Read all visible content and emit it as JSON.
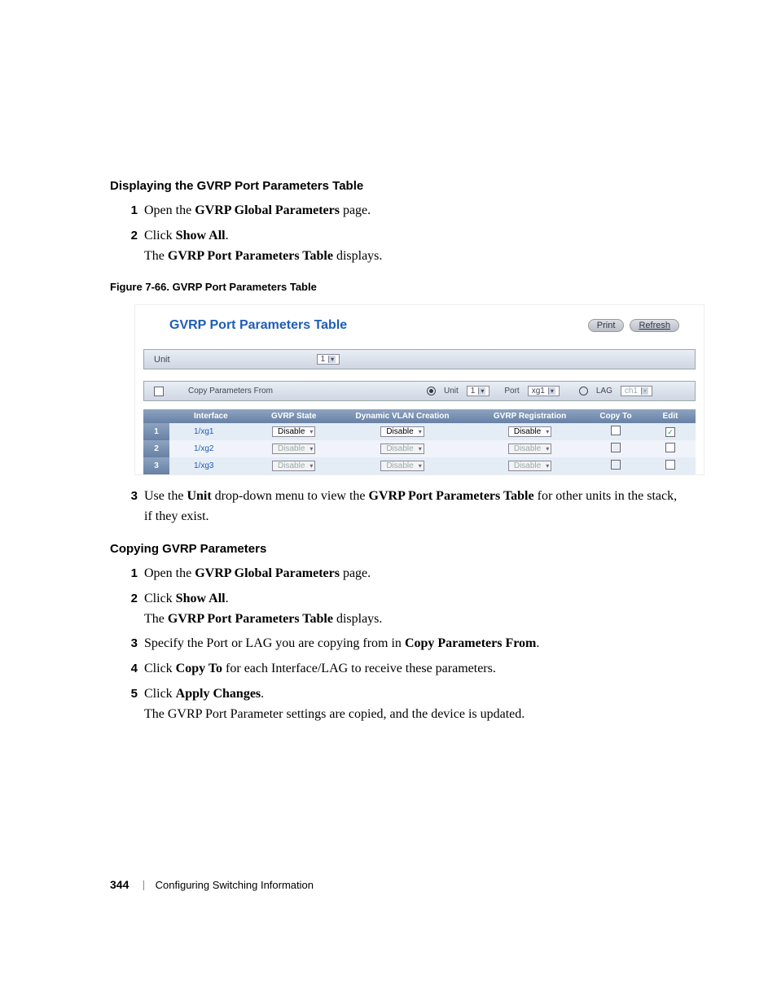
{
  "section1": {
    "heading": "Displaying the GVRP Port Parameters Table",
    "steps": [
      {
        "n": "1",
        "html": "Open the <b>GVRP Global Parameters</b> page."
      },
      {
        "n": "2",
        "html": "Click <b>Show All</b>.<br>The <b>GVRP Port Parameters Table</b> displays."
      }
    ]
  },
  "figure_caption": "Figure 7-66.    GVRP Port Parameters Table",
  "screenshot": {
    "title": "GVRP Port Parameters Table",
    "print": "Print",
    "refresh": "Refresh",
    "unit_label": "Unit",
    "unit_value": "1",
    "copy_from_label": "Copy Parameters From",
    "radio_unit_label": "Unit",
    "radio_unit_value": "1",
    "port_label": "Port",
    "port_value": "xg1",
    "radio_lag_label": "LAG",
    "lag_value": "ch1",
    "columns": {
      "interface": "Interface",
      "state": "GVRP State",
      "dvc": "Dynamic VLAN Creation",
      "reg": "GVRP Registration",
      "copyto": "Copy To",
      "edit": "Edit"
    },
    "disable": "Disable",
    "rows": [
      {
        "idx": "1",
        "iface": "1/xg1",
        "active": true,
        "edit_checked": true
      },
      {
        "idx": "2",
        "iface": "1/xg2",
        "active": false,
        "edit_checked": false
      },
      {
        "idx": "3",
        "iface": "1/xg3",
        "active": false,
        "edit_checked": false
      }
    ]
  },
  "step3": {
    "n": "3",
    "html": "Use the <b>Unit</b> drop-down menu to view the <b>GVRP Port Parameters Table</b> for other units in the stack, if they exist."
  },
  "section2": {
    "heading": "Copying GVRP Parameters",
    "steps": [
      {
        "n": "1",
        "html": "Open the <b>GVRP Global Parameters</b> page."
      },
      {
        "n": "2",
        "html": "Click <b>Show All</b>.<br>The <b>GVRP Port Parameters Table</b> displays."
      },
      {
        "n": "3",
        "html": "Specify the Port or LAG you are copying from in <b>Copy Parameters From</b>."
      },
      {
        "n": "4",
        "html": "Click <b>Copy To</b> for each Interface/LAG to receive these parameters."
      },
      {
        "n": "5",
        "html": "Click <b>Apply Changes</b>.<br>The GVRP Port Parameter settings are copied, and the device is updated."
      }
    ]
  },
  "footer": {
    "page": "344",
    "chapter": "Configuring Switching Information"
  }
}
